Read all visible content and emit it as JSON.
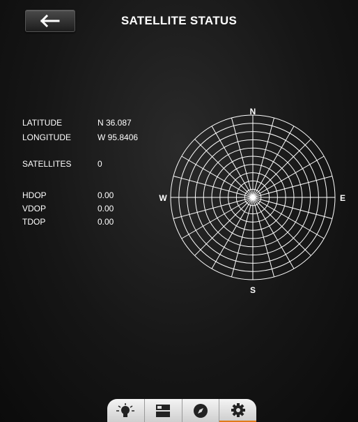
{
  "header": {
    "title": "SATELLITE STATUS"
  },
  "info": {
    "latitude": {
      "label": "LATITUDE",
      "value": "N 36.087"
    },
    "longitude": {
      "label": "LONGITUDE",
      "value": "W 95.8406"
    },
    "satellites": {
      "label": "SATELLITES",
      "value": "0"
    },
    "hdop": {
      "label": "HDOP",
      "value": "0.00"
    },
    "vdop": {
      "label": "VDOP",
      "value": "0.00"
    },
    "tdop": {
      "label": "TDOP",
      "value": "0.00"
    }
  },
  "polar": {
    "north": "N",
    "south": "S",
    "east": "E",
    "west": "W"
  },
  "tabs": [
    {
      "icon": "lightbulb-icon"
    },
    {
      "icon": "layout-icon"
    },
    {
      "icon": "compass-icon"
    },
    {
      "icon": "gear-icon",
      "active": true
    }
  ],
  "colors": {
    "active_tab_accent": "#e07a1a"
  }
}
